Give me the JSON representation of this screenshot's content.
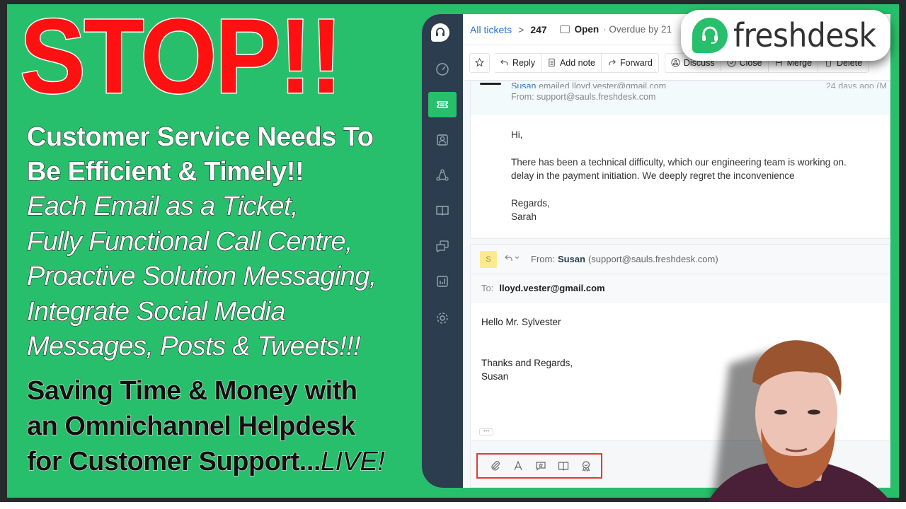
{
  "thumbnail": {
    "stop": "STOP!!",
    "headline": [
      "Customer Service Needs To",
      "Be Efficient & Timely!!"
    ],
    "features": [
      "Each Email as a Ticket,",
      "Fully Functional Call Centre,",
      "Proactive Solution Messaging,",
      "Integrate Social Media",
      "Messages, Posts & Tweets!!!"
    ],
    "tagline": [
      "Saving Time & Money with",
      "an Omnichannel Helpdesk",
      "for Customer Support..."
    ],
    "tagline_live": "LIVE!",
    "colors": {
      "background": "#28bf6c",
      "stop": "#ff1111",
      "frame": "#262a2c"
    }
  },
  "brand": {
    "name": "freshdesk",
    "color": "#28bf6c"
  },
  "sidebar": {
    "items": [
      {
        "name": "logo",
        "icon": "headset-icon"
      },
      {
        "name": "dashboard",
        "icon": "gauge-icon"
      },
      {
        "name": "tickets",
        "icon": "ticket-icon",
        "active": true
      },
      {
        "name": "contacts",
        "icon": "contact-card-icon"
      },
      {
        "name": "groups",
        "icon": "network-icon"
      },
      {
        "name": "solutions",
        "icon": "book-icon"
      },
      {
        "name": "discussions",
        "icon": "chat-bubbles-icon"
      },
      {
        "name": "reports",
        "icon": "bar-chart-icon"
      },
      {
        "name": "admin",
        "icon": "gear-icon"
      }
    ]
  },
  "header": {
    "breadcrumb_link": "All tickets",
    "separator": ">",
    "ticket_number": "247",
    "status": "Open",
    "overdue": "· Overdue by 21"
  },
  "toolbar": {
    "reply": "Reply",
    "add_note": "Add note",
    "forward": "Forward",
    "discuss": "Discuss",
    "close": "Close",
    "merge": "Merge",
    "delete": "Delete"
  },
  "message": {
    "sender": "Susan",
    "action": "emailed lloyd.vester@gmail.com",
    "from": "From: support@sauls.freshdesk.com",
    "time": "24 days ago (M",
    "body": {
      "greeting": "Hi,",
      "line1": "There has been a technical difficulty, which our engineering team is working on.",
      "line2": "delay in the payment initiation. We deeply regret the inconvenience",
      "signoff": "Regards,",
      "signature": "Sarah"
    }
  },
  "reply": {
    "avatar_letter": "S",
    "from_label": "From:",
    "from_name": "Susan",
    "from_address": "(support@sauls.freshdesk.com)",
    "to_label": "To:",
    "to_value": "lloyd.vester@gmail.com",
    "body": {
      "greeting": "Hello Mr. Sylvester",
      "signoff": "Thanks and Regards,",
      "signature": "Susan"
    },
    "ellipsis": "•••",
    "format_tools": [
      "attachment-icon",
      "text-format-icon",
      "canned-response-icon",
      "solution-article-icon",
      "survey-icon"
    ]
  }
}
